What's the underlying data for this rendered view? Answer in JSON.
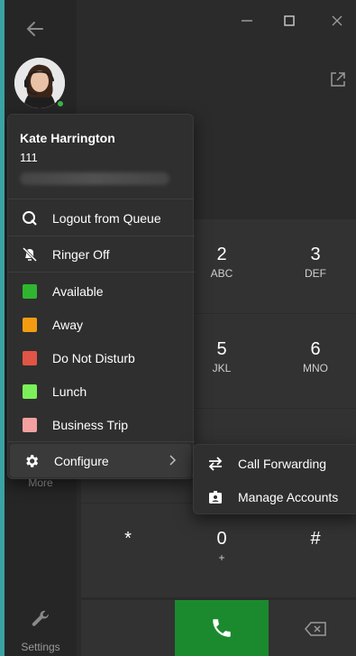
{
  "user": {
    "name": "Kate Harrington",
    "extension": "111"
  },
  "status_menu": {
    "logout_queue": "Logout from Queue",
    "ringer": "Ringer Off",
    "statuses": [
      {
        "label": "Available",
        "color": "#2fb52f"
      },
      {
        "label": "Away",
        "color": "#f39c12"
      },
      {
        "label": "Do Not Disturb",
        "color": "#e05545"
      },
      {
        "label": "Lunch",
        "color": "#7bf05a"
      },
      {
        "label": "Business Trip",
        "color": "#f2a0a0"
      }
    ],
    "configure": "Configure"
  },
  "configure_submenu": {
    "call_forwarding": "Call Forwarding",
    "manage_accounts": "Manage Accounts"
  },
  "dialpad": {
    "keys": [
      {
        "digit": "2",
        "letters": "ABC"
      },
      {
        "digit": "3",
        "letters": "DEF"
      },
      {
        "digit": "5",
        "letters": "JKL"
      },
      {
        "digit": "6",
        "letters": "MNO"
      },
      {
        "digit": "*",
        "letters": ""
      },
      {
        "digit": "0",
        "letters": "+"
      },
      {
        "digit": "#",
        "letters": ""
      }
    ]
  },
  "sidebar": {
    "more_label": "More",
    "settings_label": "Settings"
  },
  "colors": {
    "call_button": "#1b8a2f",
    "presence": "#3bb54a"
  }
}
